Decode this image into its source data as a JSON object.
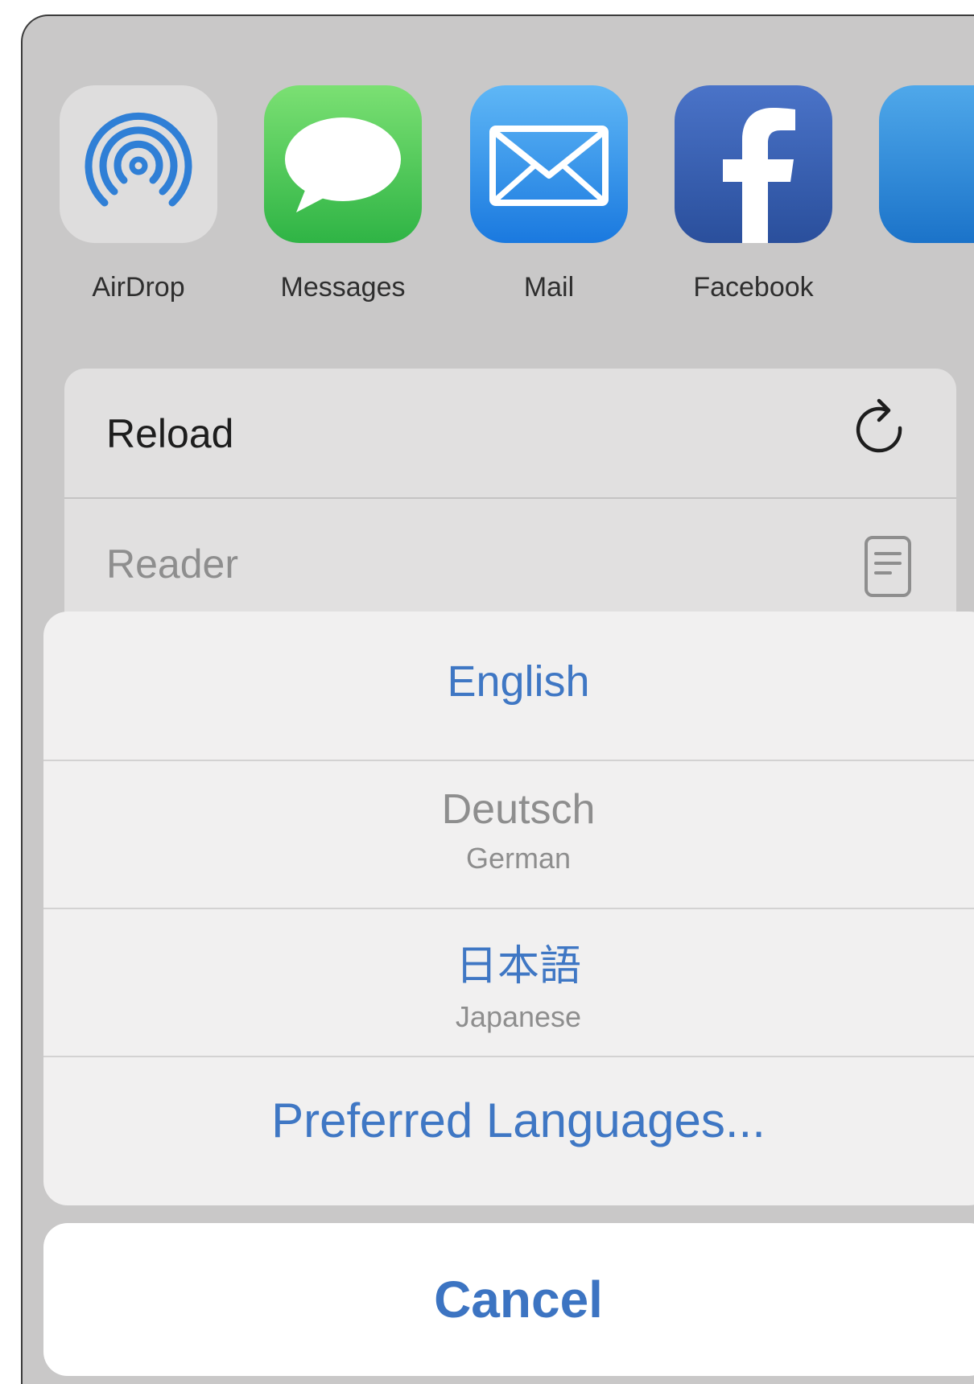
{
  "share_apps": [
    {
      "label": "AirDrop",
      "icon": "airdrop-icon"
    },
    {
      "label": "Messages",
      "icon": "messages-icon"
    },
    {
      "label": "Mail",
      "icon": "mail-icon"
    },
    {
      "label": "Facebook",
      "icon": "facebook-icon"
    }
  ],
  "actions": [
    {
      "label": "Reload",
      "icon": "reload-icon"
    },
    {
      "label": "Reader",
      "icon": "reader-icon"
    }
  ],
  "languages": [
    {
      "label": "English",
      "sub": ""
    },
    {
      "label": "Deutsch",
      "sub": "German"
    },
    {
      "label": "日本語",
      "sub": "Japanese"
    }
  ],
  "preferred_languages_label": "Preferred Languages...",
  "cancel_label": "Cancel",
  "colors": {
    "accent": "#3f77c4",
    "disabled": "#8e8e8e"
  }
}
